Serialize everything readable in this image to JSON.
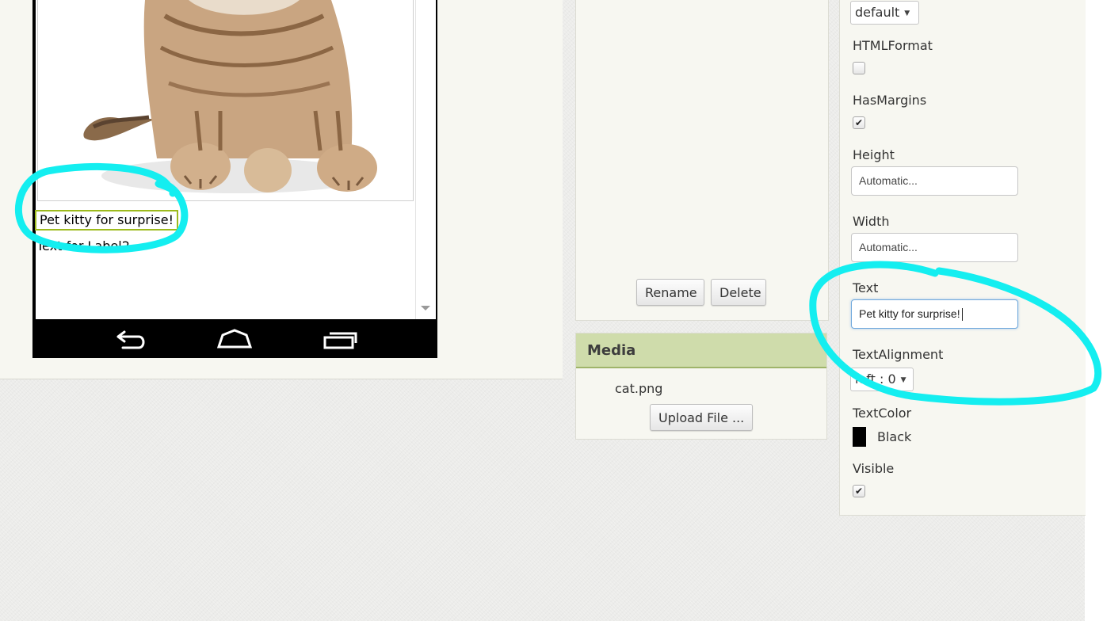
{
  "colors": {
    "label_highlight": "#9dba1d",
    "media_header_bg": "#cfdcab",
    "annotation": "#14eef0",
    "text_color_swatch": "#000000"
  },
  "viewer": {
    "label1_text": "Pet kitty for surprise!",
    "label2_text": "Text for Label2",
    "image_name": "cat-image",
    "nav_icons": [
      "back-icon",
      "home-icon",
      "recent-apps-icon"
    ]
  },
  "assets": {
    "rename_label": "Rename",
    "delete_label": "Delete"
  },
  "media": {
    "title": "Media",
    "files": [
      "cat.png"
    ],
    "upload_label": "Upload File ..."
  },
  "properties": {
    "font_typeface_value": "default",
    "html_format_label": "HTMLFormat",
    "html_format_checked": false,
    "has_margins_label": "HasMargins",
    "has_margins_checked": true,
    "height_label": "Height",
    "height_value": "Automatic...",
    "width_label": "Width",
    "width_value": "Automatic...",
    "text_label": "Text",
    "text_value": "Pet kitty for surprise!",
    "text_alignment_label": "TextAlignment",
    "text_alignment_value": "left : 0",
    "text_color_label": "TextColor",
    "text_color_value": "Black",
    "visible_label": "Visible",
    "visible_checked": true
  }
}
